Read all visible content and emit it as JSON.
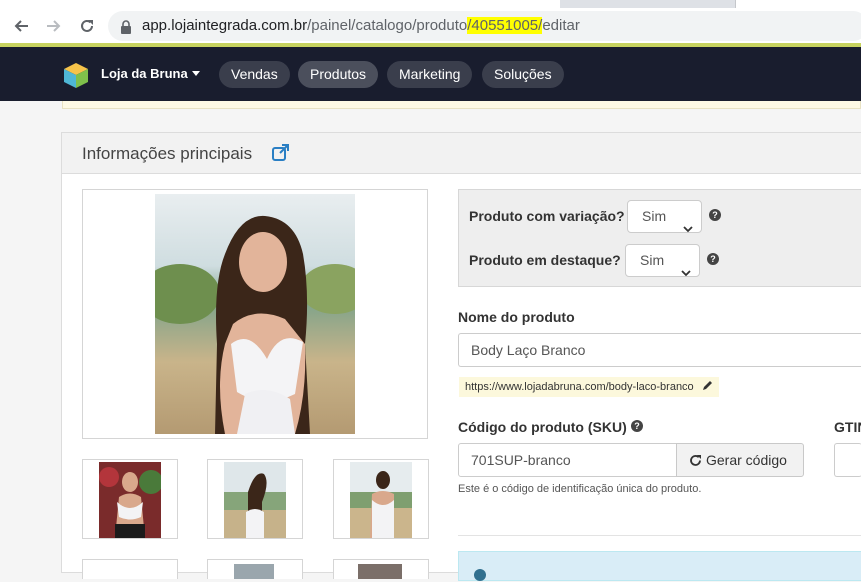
{
  "browser": {
    "url_host": "app.lojaintegrada.com.br",
    "url_path_pre": "/painel/catalogo/produto",
    "url_highlight": "/40551005/",
    "url_path_post": "editar",
    "icons": {
      "back": "arrow-left-icon",
      "forward": "arrow-right-icon",
      "reload": "reload-icon",
      "lock": "lock-icon"
    }
  },
  "nav": {
    "store_name": "Loja da Bruna",
    "items": [
      {
        "label": "Vendas"
      },
      {
        "label": "Produtos",
        "active": true
      },
      {
        "label": "Marketing"
      },
      {
        "label": "Soluções"
      }
    ]
  },
  "panel": {
    "title": "Informações principais",
    "variation_label": "Produto com variação?",
    "variation_value": "Sim",
    "featured_label": "Produto em destaque?",
    "featured_value": "Sim",
    "name_label": "Nome do produto",
    "name_value": "Body Laço Branco",
    "slug_url": "https://www.lojadabruna.com/body-laco-branco",
    "sku_label": "Código do produto (SKU)",
    "sku_value": "701SUP-branco",
    "generate_label": "Gerar código",
    "sku_hint": "Este é o código de identificação única do produto.",
    "gtin_label": "GTIN"
  },
  "colors": {
    "nav_bg": "#191d2e",
    "pill_bg": "#3a3e4c",
    "accent_line": "#c7d35f",
    "link_blue": "#2a7fc4",
    "url_highlight": "#ffff00"
  }
}
